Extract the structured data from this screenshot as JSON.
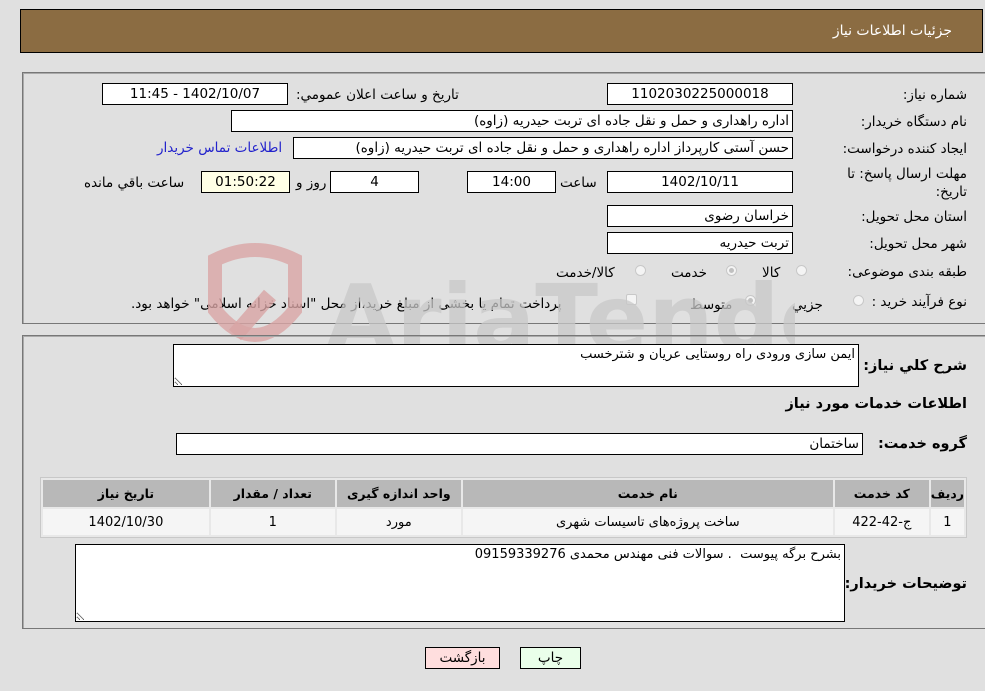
{
  "header": {
    "title": "جزئیات اطلاعات نیاز"
  },
  "form": {
    "need_number": {
      "label": "شماره نیاز:",
      "value": "1102030225000018"
    },
    "announce_datetime": {
      "label": "تاریخ و ساعت اعلان عمومي:",
      "value": "1402/10/07 - 11:45"
    },
    "buyer_org": {
      "label": "نام دستگاه خریدار:",
      "value": "اداره راهداری و حمل و نقل جاده ای تربت حیدریه (زاوه)"
    },
    "requester": {
      "label": "ایجاد کننده درخواست:",
      "value": "حسن آستی کارپرداز اداره راهداری و حمل و نقل جاده ای تربت حیدریه (زاوه)"
    },
    "buyer_contact_link": "اطلاعات تماس خریدار",
    "deadline": {
      "label": "مهلت ارسال پاسخ: تا تاریخ:",
      "date": "1402/10/11",
      "time_label": "ساعت",
      "time": "14:00",
      "days": "4",
      "days_label": "روز و",
      "remaining": "01:50:22",
      "remaining_label": "ساعت باقي مانده"
    },
    "province": {
      "label": "استان محل تحویل:",
      "value": "خراسان رضوی"
    },
    "city": {
      "label": "شهر محل تحویل:",
      "value": "تربت حیدریه"
    },
    "category": {
      "label": "طبقه بندی موضوعی:",
      "options": [
        "کالا",
        "خدمت",
        "کالا/خدمت"
      ],
      "selected": "خدمت"
    },
    "purchase_type": {
      "label": "نوع فرآیند خرید :",
      "options": [
        "جزيي",
        "متوسط"
      ],
      "selected": "متوسط",
      "treasury_note": "پرداخت تمام یا بخشی از مبلغ خرید،از محل \"اسناد خزانه اسلامی\" خواهد بود."
    }
  },
  "details": {
    "description_label": "شرح کلي نیاز:",
    "description": "ایمن سازی ورودی راه روستایی عریان و شترخسب",
    "services_heading": "اطلاعات خدمات مورد نیاز",
    "service_group_label": "گروه خدمت:",
    "service_group": "ساختمان",
    "table": {
      "headers": [
        "ردیف",
        "کد خدمت",
        "نام خدمت",
        "واحد اندازه گیری",
        "تعداد / مقدار",
        "تاریخ نیاز"
      ],
      "rows": [
        [
          "1",
          "ج-42-422",
          "ساخت پروژه‌های تاسیسات شهری",
          "مورد",
          "1",
          "1402/10/30"
        ]
      ]
    },
    "buyer_notes_label": "توضیحات خریدار:",
    "buyer_notes": "بشرح برگه پیوست  . سوالات فنی مهندس محمدی 09159339276"
  },
  "buttons": {
    "print": "چاپ",
    "back": "بازگشت"
  },
  "watermark": {
    "text": "AriaTender.neT"
  },
  "colors": {
    "header_bg": "#8b6c42",
    "link": "#2222cc",
    "print_bg": "#eaffea",
    "back_bg": "#ffdede"
  }
}
